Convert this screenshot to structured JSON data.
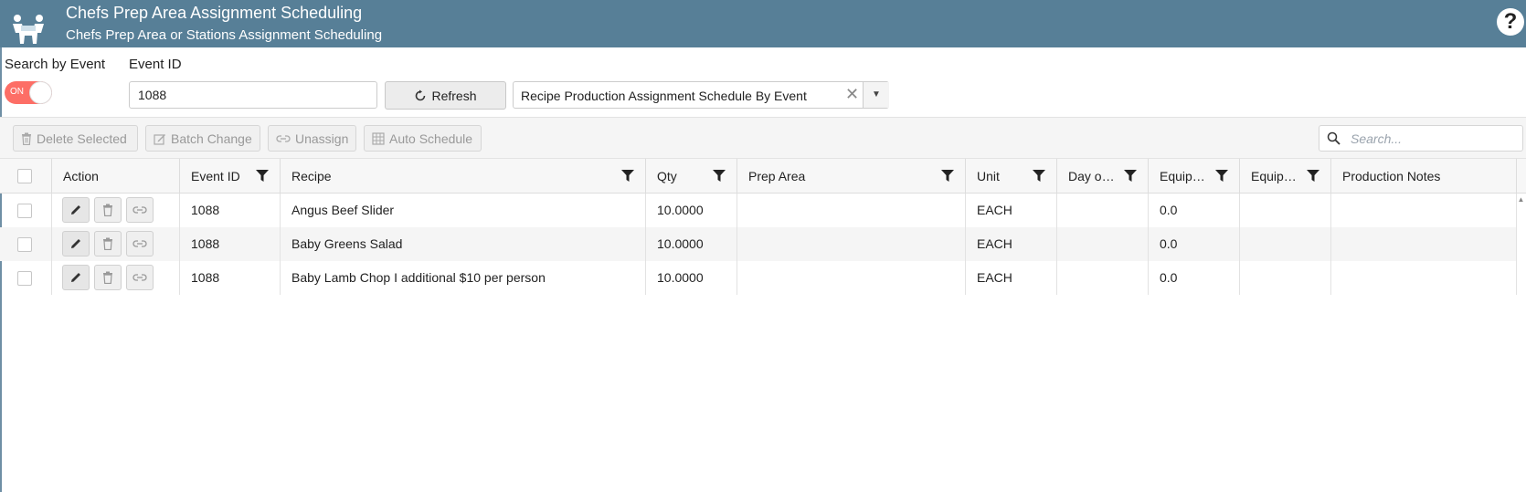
{
  "header": {
    "title": "Chefs Prep Area Assignment Scheduling",
    "subtitle": "Chefs Prep Area or Stations Assignment Scheduling",
    "help_icon": "question-circle-icon",
    "help_label": "?"
  },
  "filters": {
    "search_by_event_label": "Search by Event",
    "toggle_state": "ON",
    "event_id_label": "Event ID",
    "event_id_value": "1088",
    "refresh_label": "Refresh",
    "report_select_value": "Recipe Production Assignment Schedule By Event",
    "clear_symbol": "✕"
  },
  "toolbar": {
    "delete_selected": "Delete Selected",
    "batch_change": "Batch Change",
    "unassign": "Unassign",
    "auto_schedule": "Auto Schedule",
    "search_placeholder": "Search..."
  },
  "grid": {
    "columns": [
      "Action",
      "Event ID",
      "Recipe",
      "Qty",
      "Prep Area",
      "Unit",
      "Day o…",
      "Equip…",
      "Equip…",
      "Production Notes"
    ],
    "rows": [
      {
        "event_id": "1088",
        "recipe": "Angus Beef Slider",
        "qty": "10.0000",
        "prep_area": "",
        "unit": "EACH",
        "day": "",
        "equip1": "0.0",
        "equip2": "",
        "notes": ""
      },
      {
        "event_id": "1088",
        "recipe": "Baby Greens Salad",
        "qty": "10.0000",
        "prep_area": "",
        "unit": "EACH",
        "day": "",
        "equip1": "0.0",
        "equip2": "",
        "notes": ""
      },
      {
        "event_id": "1088",
        "recipe": "Baby Lamb Chop I additional $10 per person",
        "qty": "10.0000",
        "prep_area": "",
        "unit": "EACH",
        "day": "",
        "equip1": "0.0",
        "equip2": "",
        "notes": ""
      }
    ]
  },
  "colors": {
    "header_bg": "#577f97",
    "toggle_on": "#fd6e66"
  }
}
